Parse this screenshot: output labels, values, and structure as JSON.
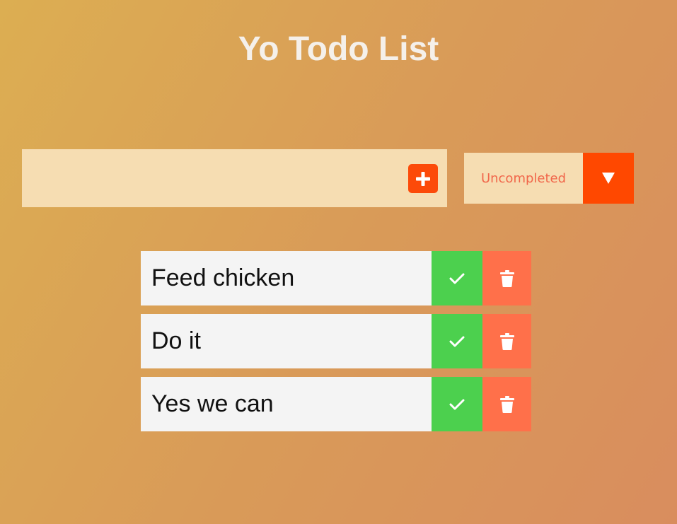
{
  "header": {
    "title": "Yo Todo List"
  },
  "form": {
    "input_value": "",
    "add_icon": "plus-icon",
    "add_color": "#fc4a09"
  },
  "filter": {
    "selected": "Uncompleted",
    "arrow_icon": "triangle-down-icon",
    "arrow_color": "#ff4800"
  },
  "todos": [
    {
      "text": "Feed chicken"
    },
    {
      "text": "Do it"
    },
    {
      "text": "Yes we can"
    }
  ],
  "icons": {
    "complete": "check-icon",
    "delete": "trash-icon"
  },
  "colors": {
    "complete": "#4cd04e",
    "delete": "#ff704a",
    "item_bg": "#f4f4f4",
    "input_bg": "#f6ddb2"
  }
}
